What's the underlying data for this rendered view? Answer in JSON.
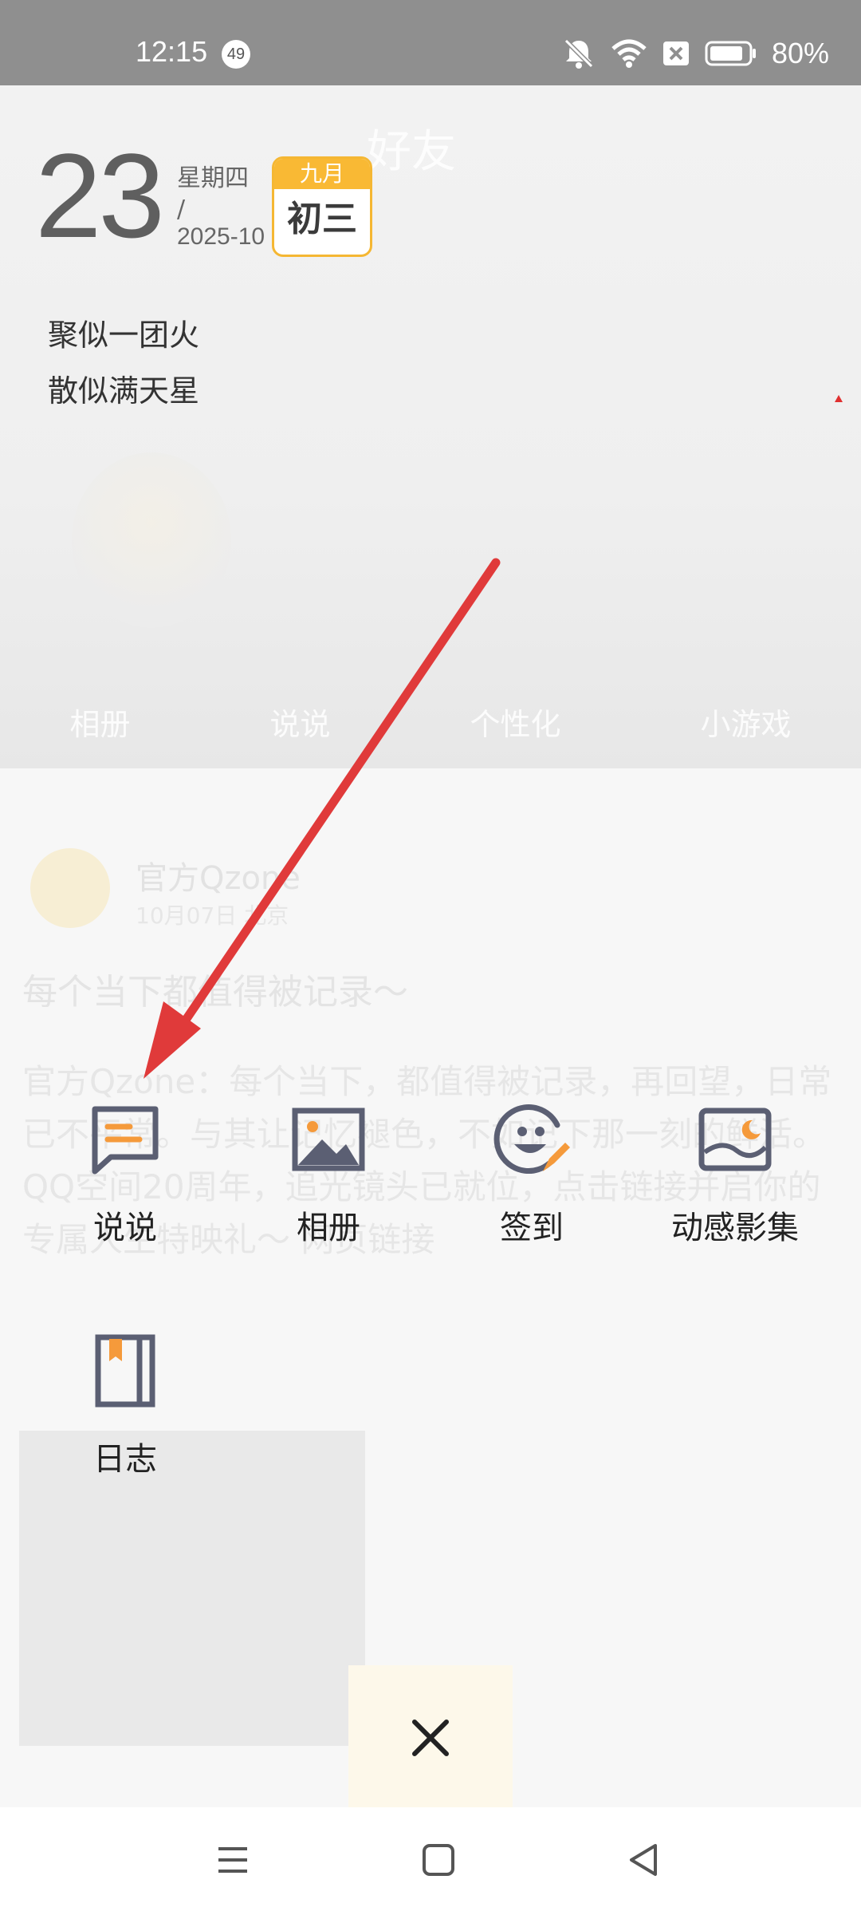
{
  "status_bar": {
    "time": "12:15",
    "notification_count": "49",
    "battery_percent": "80%"
  },
  "background_app": {
    "title": "好友",
    "tabs": [
      "相册",
      "说说",
      "个性化",
      "小游戏"
    ],
    "feed": {
      "author": "官方Qzone",
      "date": "10月07日 北京",
      "heading": "每个当下都值得被记录～",
      "body": "官方Qzone：每个当下，都值得被记录，再回望，日常已不平常。与其让记忆褪色，不如记下那一刻的鲜活。QQ空间20周年，追光镜头已就位，点击链接并启你的专属人生特映礼～ 网页链接"
    }
  },
  "calendar": {
    "day": "23",
    "weekday": "星期四",
    "separator": "/",
    "year_month": "2025-10",
    "lunar_month": "九月",
    "lunar_day": "初三"
  },
  "quote": {
    "line1": "聚似一团火",
    "line2": "散似满天星"
  },
  "publish_menu": {
    "items": [
      {
        "label": "说说",
        "icon": "speech-bubble-icon"
      },
      {
        "label": "相册",
        "icon": "photo-album-icon"
      },
      {
        "label": "签到",
        "icon": "check-in-smile-icon"
      },
      {
        "label": "动感影集",
        "icon": "dynamic-album-icon"
      },
      {
        "label": "日志",
        "icon": "journal-book-icon"
      }
    ],
    "accent_color": "#f59a3b",
    "icon_color": "#5b5f73"
  },
  "annotation": {
    "arrow_color": "#e03a3a"
  }
}
